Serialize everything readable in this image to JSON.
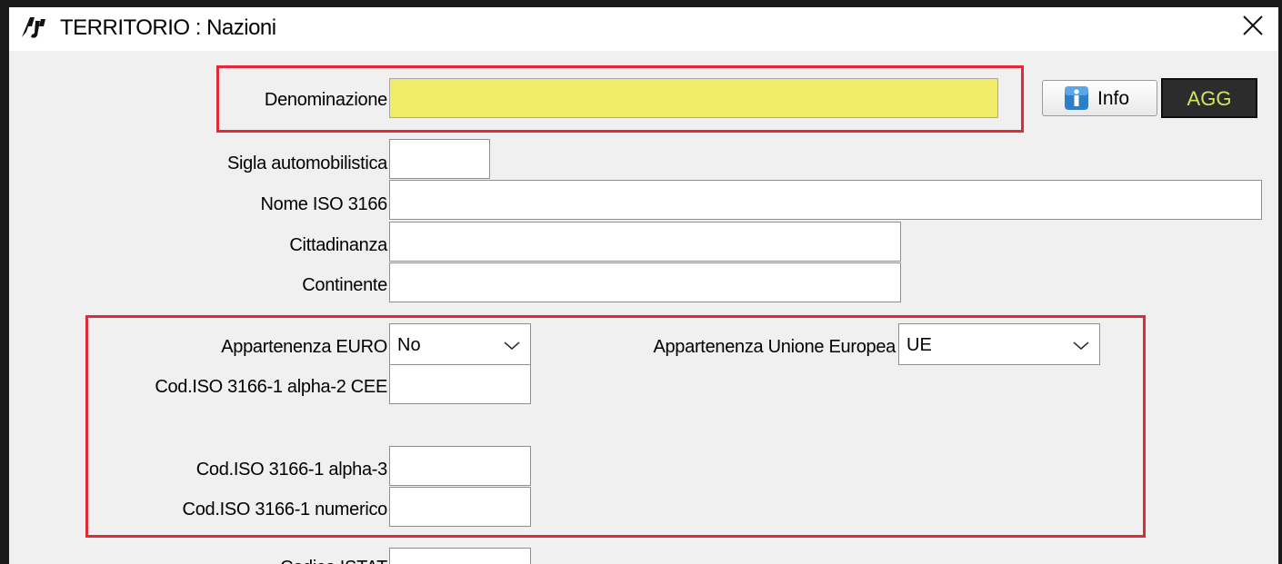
{
  "window": {
    "title": "TERRITORIO : Nazioni",
    "app_icon": "app-logo-icon",
    "close_icon": "close-icon"
  },
  "toolbar": {
    "info_label": "Info",
    "info_icon": "info-icon",
    "agg_label": "AGG"
  },
  "form": {
    "denominazione": {
      "label": "Denominazione",
      "value": ""
    },
    "sigla": {
      "label": "Sigla automobilistica",
      "value": ""
    },
    "nome_iso": {
      "label": "Nome ISO 3166",
      "value": ""
    },
    "cittadinanza": {
      "label": "Cittadinanza",
      "value": ""
    },
    "continente": {
      "label": "Continente",
      "value": ""
    },
    "euro": {
      "label": "Appartenenza EURO",
      "value": "No"
    },
    "ue": {
      "label": "Appartenenza Unione Europea",
      "value": "UE"
    },
    "alpha2": {
      "label": "Cod.ISO 3166-1 alpha-2 CEE",
      "value": ""
    },
    "alpha3": {
      "label": "Cod.ISO 3166-1 alpha-3",
      "value": ""
    },
    "numerico": {
      "label": "Cod.ISO 3166-1 numerico",
      "value": ""
    },
    "istat": {
      "label": "Codice ISTAT",
      "value": ""
    }
  },
  "colors": {
    "highlight_border": "#e02a35",
    "required_field": "#f2ec6b",
    "agg_text": "#d3e65a"
  }
}
